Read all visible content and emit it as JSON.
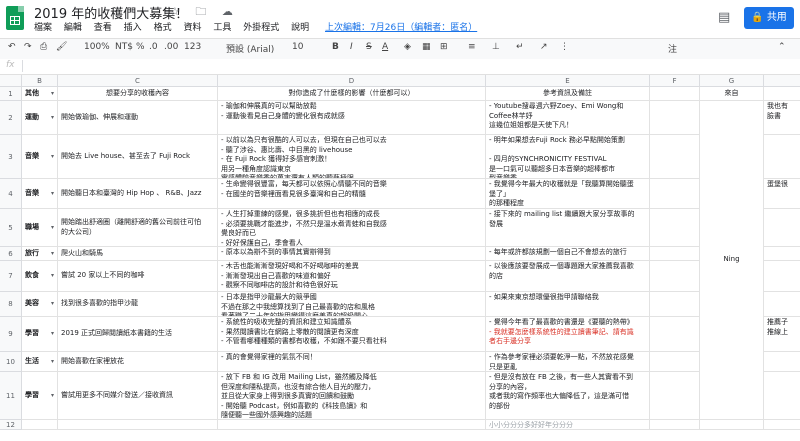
{
  "doc": {
    "title": "2019 年的收穫們大募集！",
    "title_icons": "☆ 🗀 ☁",
    "menus": [
      "檔案",
      "編輯",
      "查看",
      "插入",
      "格式",
      "資料",
      "工具",
      "外掛程式",
      "說明"
    ],
    "last_edit": "上次編輯：7月26日（編輯者：匿名）",
    "share_label": "共用",
    "comment_icon": "comment-icon",
    "accent_color": "#1a73e8",
    "brand_color": "#0f9d58"
  },
  "toolbar": {
    "undo": "↶",
    "redo": "↷",
    "print": "⎙",
    "paint": "🖌",
    "zoom": "100%",
    "currency": "NT$",
    "percent": "%",
    "dec_less": ".0",
    "dec_more": ".00",
    "format_more": "123",
    "font": "預設 (Arial)",
    "font_size": "10",
    "bold": "B",
    "italic": "I",
    "strike": "S",
    "text_color": "A",
    "fill": "◈",
    "borders": "▦",
    "merge": "⊞",
    "halign": "≡",
    "valign": "⊥",
    "wrap": "↵",
    "rotate": "↗",
    "more": "⋮",
    "more_label": "注",
    "collapse": "⌃"
  },
  "formula_bar": {
    "fx": "fx",
    "value": ""
  },
  "columns": [
    "B",
    "C",
    "D",
    "E",
    "F",
    "G"
  ],
  "header_row": {
    "num": "1",
    "b": "其他",
    "c": "想要分享的收穫內容",
    "d": "對你造成了什麼樣的影響（什麼都可以）",
    "e": "參考資訊及備註",
    "f": "",
    "g": "來自"
  },
  "rows": [
    {
      "num": "2",
      "b": "運動",
      "c": "開始做瑜伽、伸展和運動",
      "d": "- 瑜伽和伸展真的可以幫助放鬆\n- 運動後看見自己身體的變化很有成就感",
      "e": "- Youtube搜尋週六野Zoey、Emi Wong和\nCoffee林芊妤\n這幾位姐姐都是天使下凡！",
      "e_red": "",
      "f": "",
      "g": "",
      "h": "我也有\n臉書"
    },
    {
      "num": "3",
      "b": "音樂",
      "c": "開始去 Live house、甚至去了 Fuji Rock",
      "d": "- 以前以為只有很酷的人可以去，但現在自己也可以去\n- 聽了涉谷、惠比壽、中目黑的 livehouse\n- 在 Fuji Rock 獲得好多感官刺激！\n用另一種角度認識東京\n實感體驗音樂季的萬害還有人類的聽藝極限",
      "e": "- 明年如果想去Fuji Rock 務必早點開始策劃\n\n- 四月的SYNCHRONICITY FESTIVAL\n是一口氣可以聽超多日本音樂的超棒都市\n型音樂季",
      "e_red": "",
      "f": "",
      "g": "",
      "h": ""
    },
    {
      "num": "4",
      "b": "音樂",
      "c": "開始聽日本和臺灣的 Hip Hop 、 R&B、Jazz",
      "d": "- 生命變得很豐富，每天都可以依照心情聽不同的音樂\n- 在國坐的音樂裡面看見很多臺灣和自己的精髓",
      "e": "- 我覺得今年最大的收穫就是「我聽算開始聽蛋\n堡了」\n的那種程度",
      "e_red": "",
      "f": "",
      "g": "",
      "h": "蛋堡很\n"
    },
    {
      "num": "5",
      "b": "職場",
      "c": "開始踏出舒適圈（離開舒適的舊公司前往可怕\n的大公司）",
      "d": "- 人生打掉重練的感覺，很多挑折但也有相應的成長\n- 必須要挑戰才能進步，不然只是溫水煮青蛙和自我感\n覺良好而已\n- 好好保護自己，季會看人",
      "e": "- 接下來的 mailing list 繼續跟大家分享故事的\n發展",
      "e_red": "",
      "f": "",
      "g": "",
      "h": ""
    },
    {
      "num": "6",
      "b": "旅行",
      "c": "爬火山和騎馬",
      "d": "- 原本以為辦不到的事情其實辦得到",
      "e": "- 每年或許都該規劃一個自己不會想去的旅行",
      "e_red": "",
      "f": "",
      "g": "",
      "h": ""
    },
    {
      "num": "7",
      "b": "飲食",
      "c": "嘗試 20 家以上不同的咖啡",
      "d": "- 木舌也能漸漸發現好喝和不好喝咖啡的差異\n- 漸漸發現出自己喜歡的味道和偏好\n- 觀察不同咖啡店的設計和待色很好玩",
      "e": "- 以後應該要發展成一個專題跟大家推薦我喜歡\n的店",
      "e_red": "",
      "f": "",
      "g": "Ning",
      "h": ""
    },
    {
      "num": "8",
      "b": "美容",
      "c": "找到很多喜歡的指甲沙龍",
      "d": "- 日本是指甲沙龍最大的競爭國\n不過在那之中我總算找到了自己最喜歡的店和風格\n看著職了二十年的指甲變得這麼美真的超級開心",
      "e": "- 如果來東京想環優很指甲請聯絡我",
      "e_red": "",
      "f": "",
      "g": "",
      "h": ""
    },
    {
      "num": "9",
      "b": "學習",
      "c": "2019 正式回歸閱讀紙本書籍的生活",
      "d": "- 系統性的吸收完整的資訊和建立知識體系\n- 果然閱讀書比在網路上零散的閱讀更有深度\n- 不管看哪種種類的書都有收穫，不如跟不要只看社科",
      "e": "- 覺得今年看了最喜歡的書還是《要聽的熱帶》",
      "e_red": "- 我就要怎麼樣系統性的建立讀書筆記、請有識\n者右手邊分享",
      "f": "",
      "g": "",
      "h": "推薦子\n推線上"
    },
    {
      "num": "10",
      "b": "生活",
      "c": "開始喜歡在家裡放花",
      "d": "- 真的會覺得家裡的氣氛不同！",
      "e": "- 作為參考家裡必須要乾淨一點，不然放花感覺\n只是更亂",
      "e_red": "",
      "f": "",
      "g": "",
      "h": ""
    },
    {
      "num": "11",
      "b": "學習",
      "c": "嘗試用更多不同媒介發送／接收資訊",
      "d": "- 放下 FB 和 IG 改用 Mailing List，雖然觸及降低\n但深度和隱私提高，也沒有綜合他人目光的壓力，\n並且從大家身上得到很多真實的回饋和鼓勵\n- 開始聽 Podcast，例如喜歡的《科技島讀》和\n隨便聽一些國外感興趣的話題",
      "e": "- 但是沒有放在 FB 之後，有一些人其實看不到\n分享的內容，\n或者我的寫作頻率也大偏降低了，這是滿可惜\n的部份",
      "e_red": "",
      "f": "",
      "g": "",
      "h": ""
    }
  ],
  "partial_row": {
    "num": "12",
    "e": "小小分分分多好好年分分分"
  }
}
